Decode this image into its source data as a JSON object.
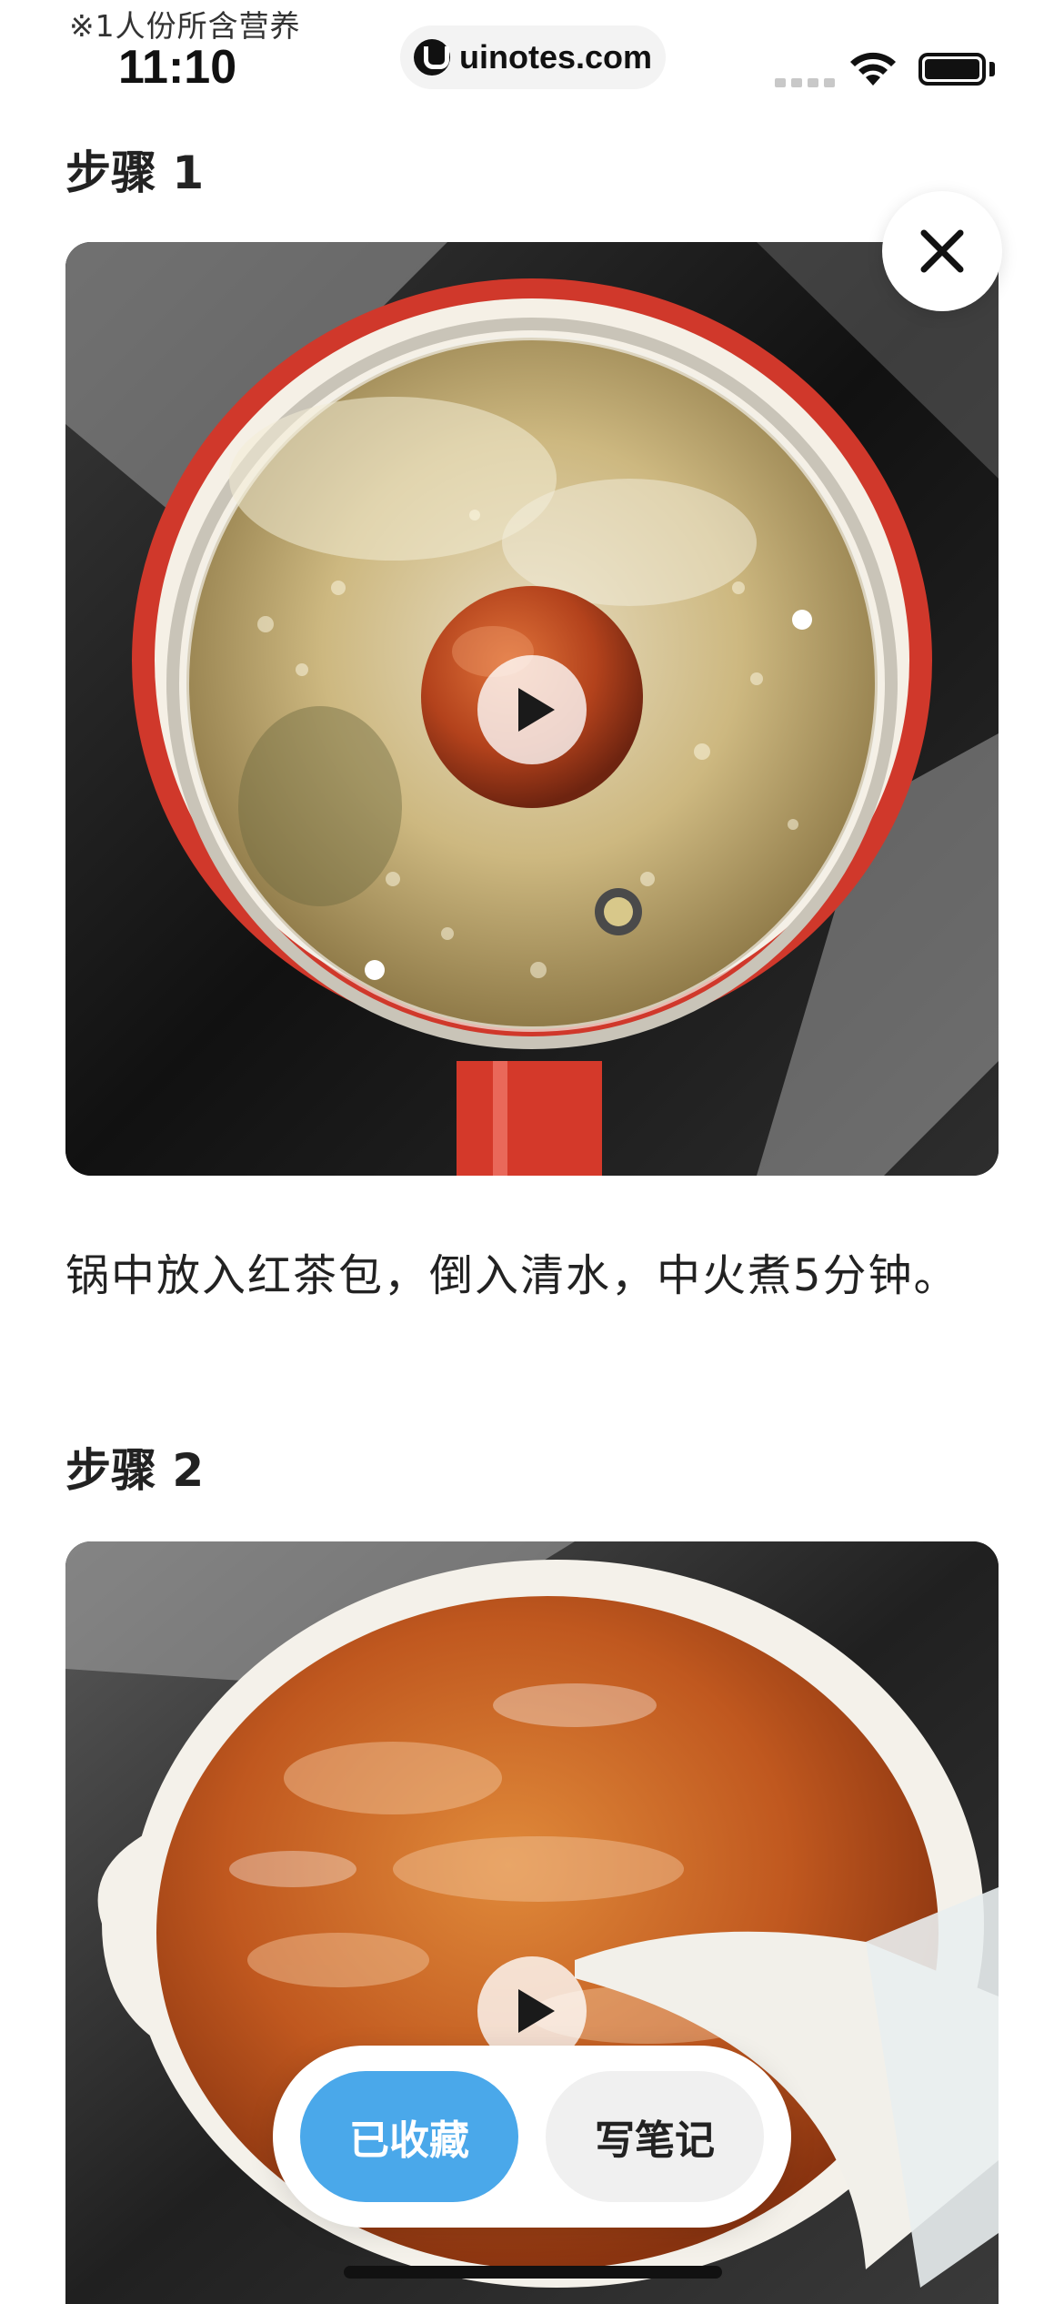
{
  "status_bar": {
    "note": "※1人份所含营养",
    "time": "11:10",
    "url": "uinotes.com"
  },
  "steps": [
    {
      "title": "步骤 1",
      "description": "锅中放入红茶包，倒入清水，中火煮5分钟。"
    },
    {
      "title": "步骤 2"
    }
  ],
  "actions": {
    "collected_label": "已收藏",
    "write_note_label": "写笔记"
  },
  "icons": {
    "close": "close-icon",
    "play": "play-icon",
    "wifi": "wifi-icon",
    "battery": "battery-icon"
  },
  "colors": {
    "accent": "#4aa8ea",
    "pot_red": "#d8392a"
  }
}
